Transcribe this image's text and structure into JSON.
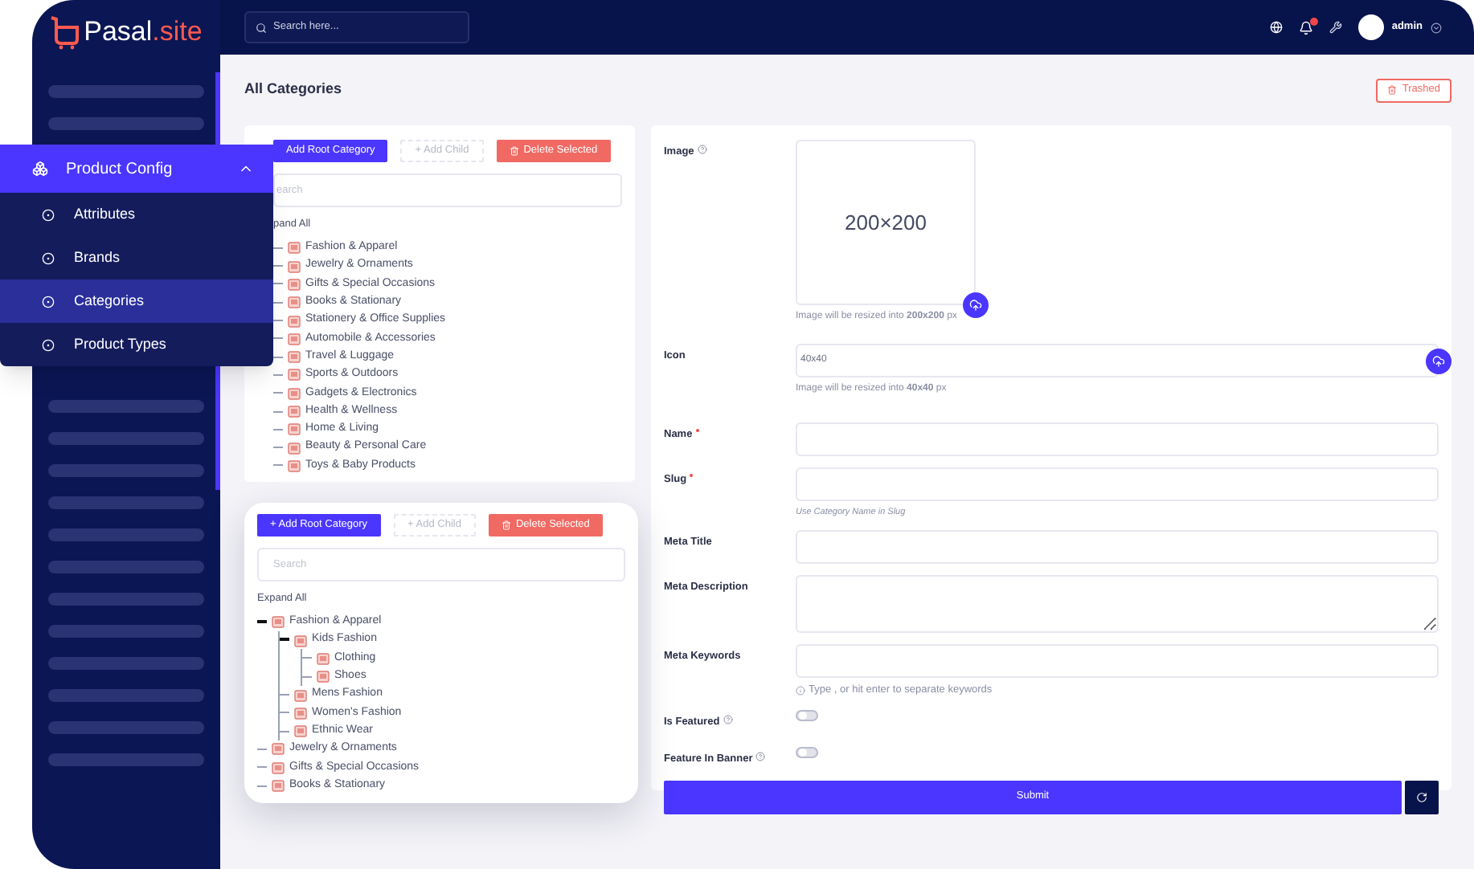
{
  "brand": {
    "name": "Pasal",
    "tld": ".site"
  },
  "topbar": {
    "search_placeholder": "Search here...",
    "user": "admin"
  },
  "page_title": "All Categories",
  "trashed_button": "Trashed",
  "menu": {
    "title": "Product Config",
    "expanded": true,
    "items": [
      {
        "label": "Attributes",
        "selected": false
      },
      {
        "label": "Brands",
        "selected": false
      },
      {
        "label": "Categories",
        "selected": true
      },
      {
        "label": "Product Types",
        "selected": false
      }
    ]
  },
  "tree_panel": {
    "buttons": [
      {
        "label": "Add Root Category",
        "kind": "primary"
      },
      {
        "label": "+ Add Child",
        "kind": "ghost"
      },
      {
        "label": "Delete Selected",
        "kind": "danger"
      }
    ],
    "search_placeholder": "earch",
    "expand_all": "pand All",
    "items": [
      {
        "label": "Fashion & Apparel"
      },
      {
        "label": "Jewelry & Ornaments"
      },
      {
        "label": "Gifts & Special Occasions"
      },
      {
        "label": "Books & Stationary"
      },
      {
        "label": "Stationery & Office Supplies"
      },
      {
        "label": "Automobile & Accessories"
      },
      {
        "label": "Travel & Luggage"
      },
      {
        "label": "Sports & Outdoors"
      },
      {
        "label": "Gadgets & Electronics"
      },
      {
        "label": "Health & Wellness"
      },
      {
        "label": "Home & Living"
      },
      {
        "label": "Beauty & Personal Care"
      },
      {
        "label": "Toys & Baby Products"
      }
    ]
  },
  "tree_popup": {
    "buttons": [
      {
        "label": "+ Add Root Category",
        "kind": "primary"
      },
      {
        "label": "+ Add Child",
        "kind": "ghost"
      },
      {
        "label": "Delete Selected",
        "kind": "danger"
      }
    ],
    "search_placeholder": "Search",
    "expand_all": "Expand All",
    "items": [
      {
        "label": "Fashion & Apparel",
        "expanded": true,
        "children": [
          {
            "label": "Kids Fashion",
            "expanded": true,
            "children": [
              {
                "label": "Clothing"
              },
              {
                "label": "Shoes"
              }
            ]
          },
          {
            "label": "Mens Fashion"
          },
          {
            "label": "Women's Fashion"
          },
          {
            "label": "Ethnic Wear"
          }
        ]
      },
      {
        "label": "Jewelry & Ornaments"
      },
      {
        "label": "Gifts & Special Occasions"
      },
      {
        "label": "Books & Stationary"
      }
    ]
  },
  "form": {
    "fields": [
      {
        "kind": "image",
        "label": "Image",
        "help": true,
        "placeholder": "200×200",
        "hint": "Image will be resized into **200x200** px"
      },
      {
        "kind": "upload",
        "label": "Icon",
        "placeholder": "40x40",
        "hint": "Image will be resized into **40x40** px"
      },
      {
        "kind": "text",
        "label": "Name",
        "required": true
      },
      {
        "kind": "text",
        "label": "Slug",
        "required": true,
        "note": "Use Category Name in Slug"
      },
      {
        "kind": "text",
        "label": "Meta Title"
      },
      {
        "kind": "textarea",
        "label": "Meta Description"
      },
      {
        "kind": "text",
        "label": "Meta Keywords",
        "info": "Type , or hit enter to separate keywords"
      },
      {
        "kind": "toggle",
        "label": "Is Featured",
        "help": true,
        "on": false
      },
      {
        "kind": "toggle",
        "label": "Feature In Banner",
        "help": true,
        "on": false
      }
    ],
    "submit": "Submit"
  }
}
